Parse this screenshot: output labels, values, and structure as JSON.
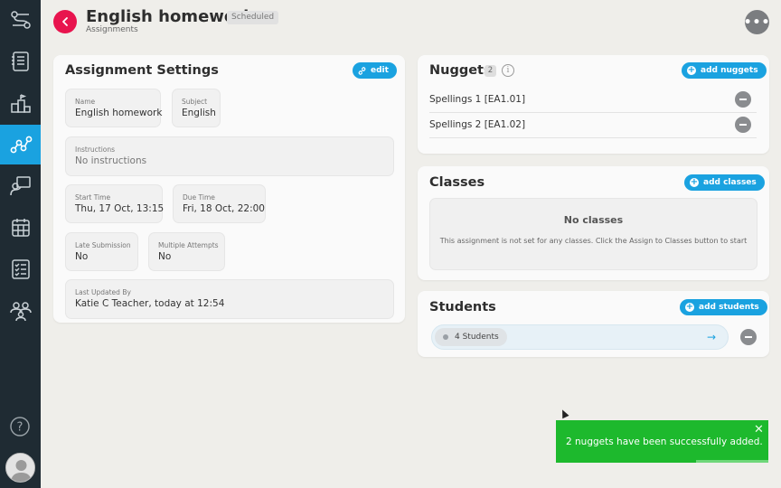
{
  "header": {
    "title": "English homework",
    "status_badge": "Scheduled",
    "breadcrumb": "Assignments",
    "more_label": "•••"
  },
  "colors": {
    "sidebar": "#1f2b33",
    "accent": "#1aa2e0",
    "back_button": "#e8144e",
    "toast": "#1db92d"
  },
  "sidebar": {
    "items": [
      {
        "icon": "flow-icon"
      },
      {
        "icon": "list-icon"
      },
      {
        "icon": "podium-icon"
      },
      {
        "icon": "path-icon",
        "active": true
      },
      {
        "icon": "presentation-icon"
      },
      {
        "icon": "calendar-icon"
      },
      {
        "icon": "checklist-icon"
      },
      {
        "icon": "group-icon"
      }
    ],
    "help_label": "?"
  },
  "settings": {
    "title": "Assignment Settings",
    "edit_label": "edit",
    "name_label": "Name",
    "name_value": "English homework",
    "subject_label": "Subject",
    "subject_value": "English",
    "instructions_label": "Instructions",
    "instructions_value": "No instructions",
    "start_label": "Start Time",
    "start_value": "Thu, 17 Oct, 13:15",
    "due_label": "Due Time",
    "due_value": "Fri, 18 Oct, 22:00",
    "late_label": "Late Submission",
    "late_value": "No",
    "attempts_label": "Multiple Attempts",
    "attempts_value": "No",
    "updated_label": "Last Updated By",
    "updated_value": "Katie C Teacher, today at 12:54"
  },
  "nuggets": {
    "title": "Nuggets",
    "count": "2",
    "info_label": "i",
    "add_label": "add nuggets",
    "items": [
      {
        "label": "Spellings 1 [EA1.01]"
      },
      {
        "label": "Spellings 2 [EA1.02]"
      }
    ]
  },
  "classes": {
    "title": "Classes",
    "add_label": "add classes",
    "empty_title": "No classes",
    "empty_desc": "This assignment is not set for any classes. Click the Assign to Classes button to start"
  },
  "students": {
    "title": "Students",
    "add_label": "add students",
    "chip_label": "4 Students",
    "arrow_label": "→"
  },
  "toast": {
    "message": "2 nuggets have been successfully added.",
    "close_label": "✕"
  }
}
